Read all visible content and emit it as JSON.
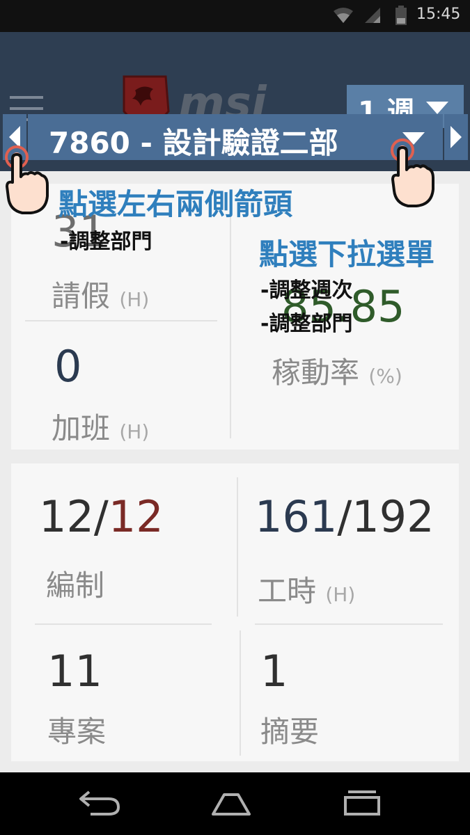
{
  "status_bar": {
    "time": "15:45"
  },
  "header": {
    "week_label": "1 週",
    "department_label": "7860 - 設計驗證二部"
  },
  "summary_cards": {
    "leave": {
      "value": "31",
      "label": "請假",
      "unit": "(H)"
    },
    "overtime": {
      "value": "0",
      "label": "加班",
      "unit": "(H)"
    },
    "utilization": {
      "value": "85.85",
      "label": "稼動率",
      "unit": "(%)"
    }
  },
  "stats_cards": {
    "headcount": {
      "value_a": "12",
      "sep": "/",
      "value_b": "12",
      "label": "編制"
    },
    "hours": {
      "value_a": "161",
      "sep": "/",
      "value_b": "192",
      "label": "工時",
      "unit": "(H)"
    },
    "projects": {
      "value": "11",
      "label": "專案"
    },
    "summary": {
      "value": "1",
      "label": "摘要"
    }
  },
  "annotations": {
    "arrows_title": "點選左右兩側箭頭",
    "arrows_sub": "-調整部門",
    "dropdown_title": "點選下拉選單",
    "dropdown_sub1": "-調整週次",
    "dropdown_sub2": "-調整部門"
  },
  "colors": {
    "header_bg": "#2e3e52",
    "button_bg": "#4a6d95",
    "annotation_blue": "#2f7fbd"
  }
}
